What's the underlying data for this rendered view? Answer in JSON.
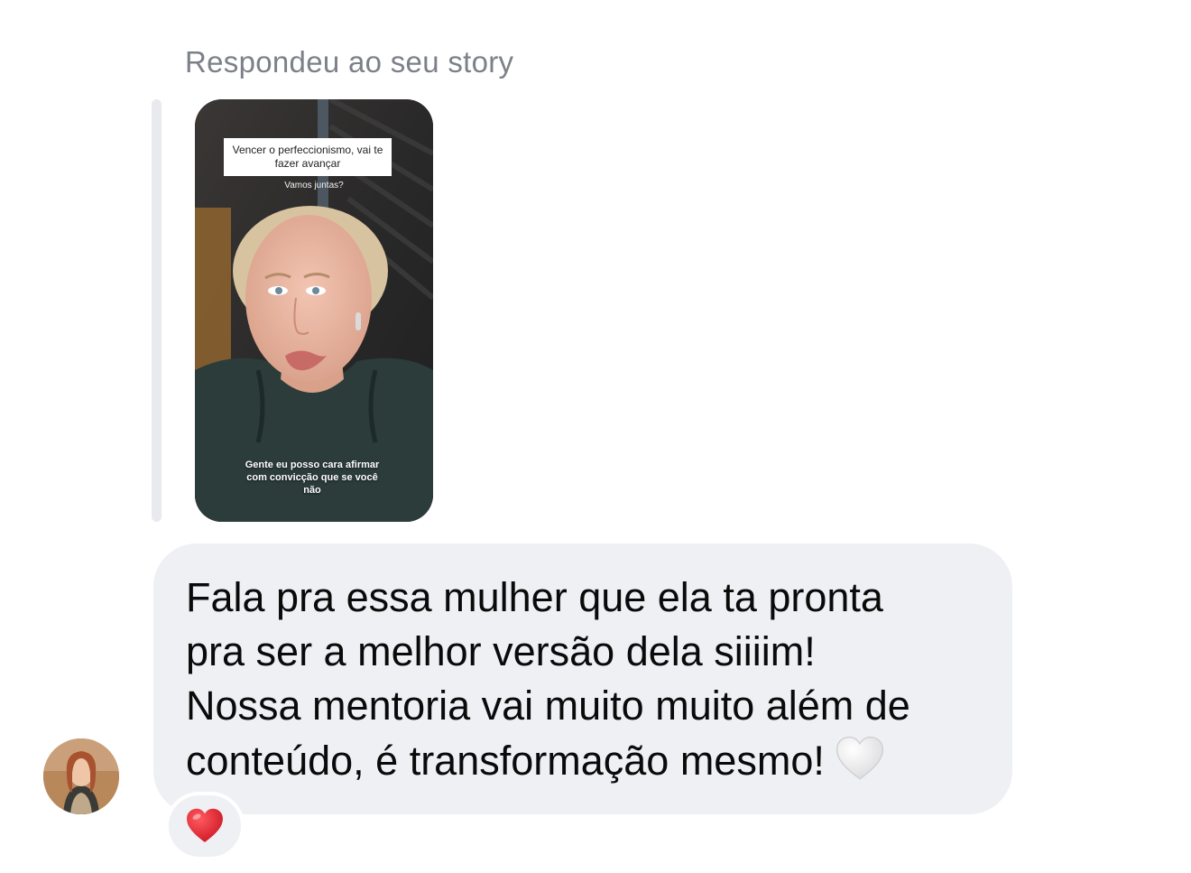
{
  "reply": {
    "label": "Respondeu ao seu story"
  },
  "story": {
    "caption": "Vencer o perfeccionismo, vai te fazer avançar",
    "sub_caption": "Vamos juntas?",
    "bottom_caption": "Gente eu posso cara afirmar com convicção que se você não"
  },
  "message": {
    "text": "Fala pra essa mulher que ela ta pronta\npra ser a melhor versão dela siiiim!\nNossa mentoria vai muito muito além de\nconteúdo, é transformação mesmo!",
    "trailing_emoji": "white-heart-icon"
  },
  "reaction": {
    "emoji": "red-heart-icon"
  },
  "colors": {
    "bubble": "#eff0f4",
    "label": "#7c8088",
    "reaction_heart": "#e0212f"
  }
}
